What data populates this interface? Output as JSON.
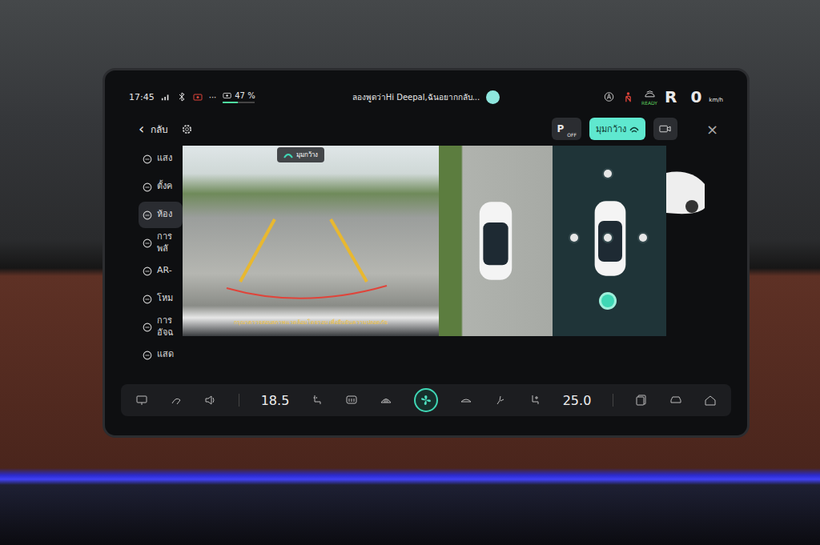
{
  "status_bar": {
    "time": "17:45",
    "more": "···",
    "battery": "47 %",
    "battery_level": 0.47,
    "voice_hint": "ลองพูดว่าHi Deepal,ฉันอยากกลับ...",
    "ready": "READY",
    "gear": "R",
    "speed": "0",
    "speed_unit": "km/h"
  },
  "nav": {
    "back_arrow": "‹",
    "back": "กลับ"
  },
  "toolbar": {
    "parking": {
      "label": "P",
      "sub": "OFF",
      "selected": false
    },
    "view_mode": {
      "label": "มุมกว้าง",
      "selected": true
    },
    "record": {
      "selected": false
    },
    "close": "×"
  },
  "sidebar": {
    "items": [
      {
        "lines": [
          "แสง"
        ],
        "selected": false
      },
      {
        "lines": [
          "ตั้งค"
        ],
        "selected": false
      },
      {
        "lines": [
          "ห้อง"
        ],
        "selected": true
      },
      {
        "lines": [
          "การ",
          "พลั"
        ],
        "selected": false
      },
      {
        "lines": [
          "AR-"
        ],
        "selected": false
      },
      {
        "lines": [
          "โหม"
        ],
        "selected": false
      },
      {
        "lines": [
          "การ",
          "อัจฉ"
        ],
        "selected": false
      },
      {
        "lines": [
          "แสด"
        ],
        "selected": false
      }
    ]
  },
  "camera": {
    "label": "มุมกว้าง",
    "warning": "กรุณาตรวจสอบสภาพแวดล้อมโดยรอบ เพื่อยืนยันความปลอดภัย"
  },
  "views": [
    {
      "position": "front",
      "selected": false
    },
    {
      "position": "left",
      "selected": false
    },
    {
      "position": "center",
      "selected": false
    },
    {
      "position": "right",
      "selected": false
    },
    {
      "position": "rear",
      "selected": true
    }
  ],
  "dock": {
    "left_temp": "18.5",
    "right_temp": "25.0",
    "fan_on": true
  }
}
